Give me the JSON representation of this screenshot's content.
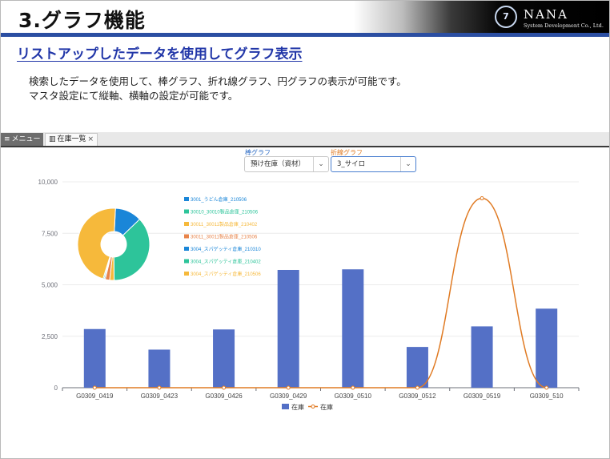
{
  "slide": {
    "title": "3.グラフ機能",
    "logo_name": "NANA",
    "logo_sub": "System Development Co., Ltd.",
    "logo_mark": "7",
    "subtitle": "リストアップしたデータを使用してグラフ表示",
    "desc_line1": "検索したデータを使用して、棒グラフ、折れ線グラフ、円グラフの表示が可能です。",
    "desc_line2": "マスタ設定にて縦軸、横軸の設定が可能です。"
  },
  "tabs": {
    "menu_label": "メニュー",
    "menu_icon": "hamburger-icon",
    "inventory_label": "在庫一覧",
    "inventory_icon": "chart-icon",
    "close_glyph": "×"
  },
  "controls": {
    "bar_label": "棒グラフ",
    "bar_value": "預け在庫（資材）",
    "line_label": "折線グラフ",
    "line_value": "3_サイロ",
    "bar_label_color": "#2f6dc5",
    "line_label_color": "#e07b24"
  },
  "chart_data": [
    {
      "type": "bar",
      "categories": [
        "G0309_0419",
        "G0309_0423",
        "G0309_0426",
        "G0309_0429",
        "G0309_0510",
        "G0309_0512",
        "G0309_0519",
        "G0309_510"
      ],
      "series": [
        {
          "name": "在庫",
          "kind": "bar",
          "color": "#5470c6",
          "values": [
            2850,
            1850,
            2830,
            5720,
            5750,
            1980,
            2980,
            3840
          ]
        },
        {
          "name": "在庫",
          "kind": "line",
          "color": "#e07b24",
          "values": [
            0,
            0,
            0,
            0,
            0,
            0,
            9200,
            0
          ]
        }
      ],
      "ylim": [
        0,
        10000
      ],
      "yticks": [
        "0",
        "2,500",
        "5,000",
        "7,500",
        "10,000"
      ],
      "ytick_values": [
        0,
        2500,
        5000,
        7500,
        10000
      ],
      "grid": true,
      "legend": "bottom-center"
    },
    {
      "type": "pie",
      "donut": true,
      "slices": [
        {
          "label": "3001_うどん倉庫_210506",
          "value": 12,
          "color": "#1a86d8"
        },
        {
          "label": "30010_30010製品倉庫_210506",
          "value": 37,
          "color": "#2dc49a"
        },
        {
          "label": "30011_30011製品倉庫_210402",
          "value": 2,
          "color": "#f6b93b"
        },
        {
          "label": "30011_30011製品倉庫_210506",
          "value": 2,
          "color": "#e8844a"
        },
        {
          "label": "3004_スパゲッティ倉庫_210310",
          "value": 0.5,
          "color": "#1a86d8"
        },
        {
          "label": "3004_スパゲッティ倉庫_210402",
          "value": 0.5,
          "color": "#2dc49a"
        },
        {
          "label": "3004_スパゲッティ倉庫_210506",
          "value": 46,
          "color": "#f6b93b"
        }
      ],
      "legend": "right"
    }
  ]
}
